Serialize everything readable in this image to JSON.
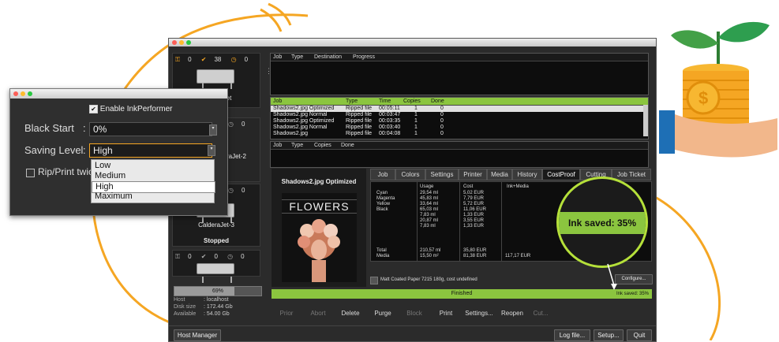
{
  "app": {
    "sidebar": {
      "printers": [
        {
          "name": "CalderaJet",
          "counts": [
            "0",
            "38",
            "0"
          ],
          "status": ""
        },
        {
          "name": "CalderaJet-2",
          "counts": [
            "0"
          ],
          "status": ""
        },
        {
          "name": "CalderaJet-3",
          "counts": [
            "0"
          ],
          "status": "Stopped"
        },
        {
          "name": "",
          "counts": [
            "0",
            "0",
            "0"
          ],
          "status": ""
        }
      ],
      "disk_progress_label": "69%",
      "disk_progress": 0.69,
      "host_label": "Host",
      "host_value": "localhost",
      "disk_size_label": "Disk size",
      "disk_size_value": "172.44 Gb",
      "available_label": "Available",
      "available_value": "54.00 Gb"
    },
    "queue_top": {
      "headers": [
        "Job",
        "Type",
        "Destination",
        "Progress"
      ]
    },
    "queue_mid": {
      "headers": [
        "Job",
        "Type",
        "Time",
        "Copies",
        "Done"
      ],
      "rows": [
        [
          "Shadows2.jpg Optimized",
          "Ripped file",
          "00:05:11",
          "1",
          "0"
        ],
        [
          "Shadows2.jpg Normal",
          "Ripped file",
          "00:03:47",
          "1",
          "0"
        ],
        [
          "Shadows2.jpg Optimized",
          "Ripped file",
          "00:03:35",
          "1",
          "0"
        ],
        [
          "Shadows2.jpg Normal",
          "Ripped file",
          "00:03:40",
          "1",
          "0"
        ],
        [
          "Shadows2.jpg",
          "Ripped file",
          "00:04:08",
          "1",
          "0"
        ]
      ]
    },
    "queue_bot": {
      "headers": [
        "Job",
        "Type",
        "Copies",
        "Done"
      ]
    },
    "detail": {
      "job_title": "Shadows2.jpg Optimized",
      "poster_title": "FLOWERS",
      "tabs": [
        "Job",
        "Colors",
        "Settings",
        "Printer",
        "Media",
        "History",
        "CostProof",
        "Cutting",
        "Job Ticket"
      ],
      "selected_tab": "CostProof",
      "cost_headers": [
        "Usage",
        "Cost",
        "Ink+Media"
      ],
      "cost_rows": [
        {
          "name": "Cyan",
          "usage": "29,54 ml",
          "cost": "5,02 EUR"
        },
        {
          "name": "Magenta",
          "usage": "45,83 ml",
          "cost": "7,79 EUR"
        },
        {
          "name": "Yellow",
          "usage": "33,64 ml",
          "cost": "5,72 EUR"
        },
        {
          "name": "Black",
          "usage": "65,03 ml",
          "cost": "11,06 EUR"
        },
        {
          "name": "",
          "usage": "7,83 ml",
          "cost": "1,33 EUR"
        },
        {
          "name": "",
          "usage": "20,87 ml",
          "cost": "3,55 EUR"
        },
        {
          "name": "",
          "usage": "7,83 ml",
          "cost": "1,33 EUR"
        }
      ],
      "total_label": "Total",
      "total_usage": "210,57 ml",
      "total_cost": "35,80 EUR",
      "media_label": "Media",
      "media_usage": "15,50 m²",
      "media_cost": "81,38 EUR",
      "ink_media_total": "117,17 EUR",
      "paper_text": "Matt Coated Paper 7215 180g, cost undefined",
      "configure_label": "Configure...",
      "status_text": "Finished",
      "status_right": "Ink saved: 35%",
      "ink_saved_big": "Ink saved: 35%"
    },
    "toolbar": [
      "Prior",
      "Abort",
      "Delete",
      "Purge",
      "Block",
      "Print",
      "Settings...",
      "Reopen",
      "Cut..."
    ],
    "toolbar_disabled": [
      true,
      true,
      false,
      false,
      true,
      false,
      false,
      false,
      true
    ],
    "bottom_left_button": "Host Manager",
    "bottom_right_buttons": [
      "Log file...",
      "Setup...",
      "Quit"
    ]
  },
  "ink": {
    "enable_label": "Enable InkPerformer",
    "black_start_label": "Black Start",
    "black_start_value": "0%",
    "saving_level_label": "Saving Level",
    "saving_level_value": "High",
    "rip_print_label": "Rip/Print twic",
    "options": [
      "Low",
      "Medium",
      "High",
      "Maximum"
    ],
    "selected_option": "High"
  },
  "colors": {
    "accent_green": "#8bc53f",
    "arc_orange": "#f5a623",
    "coin_gold": "#f7b731"
  }
}
